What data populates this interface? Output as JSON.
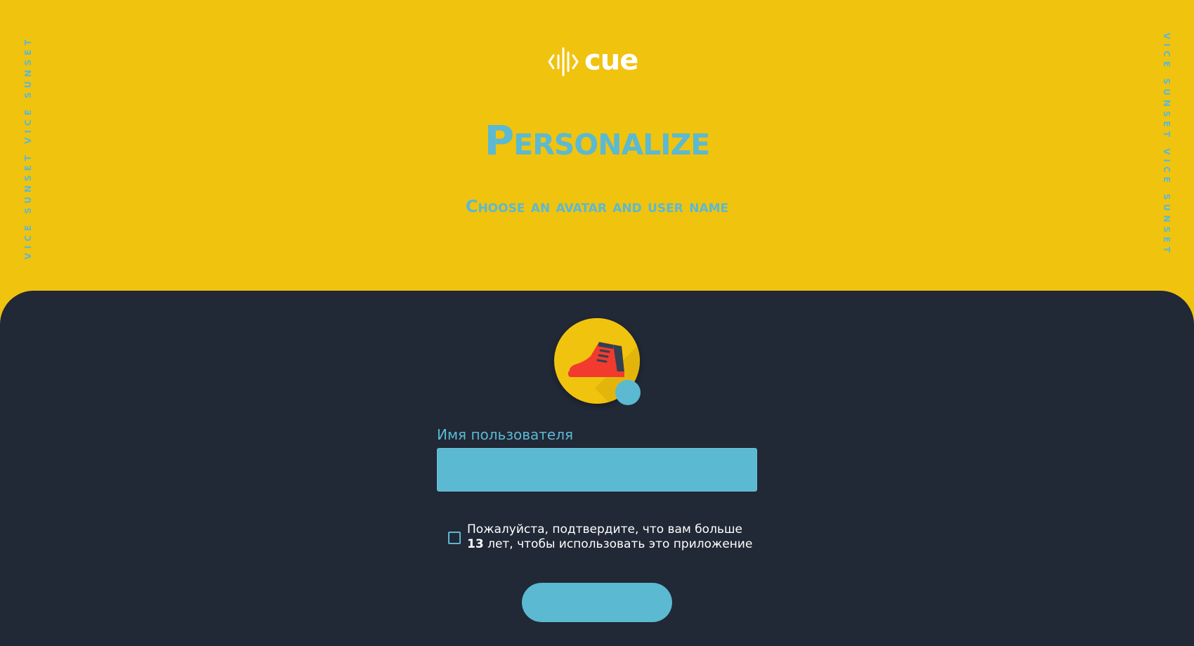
{
  "brand": {
    "logo_text": "cue",
    "icon": "waveform-icon"
  },
  "side_text": {
    "left": "VICE SUNSET VICE SUNSET",
    "right": "VICE SUNSET VICE SUNSET"
  },
  "header": {
    "title": "Personalize",
    "subtitle": "Choose an avatar and user name"
  },
  "avatar": {
    "icon": "sneaker-icon",
    "edit_icon": "avatar-edit-dot"
  },
  "form": {
    "username_label": "Имя пользователя",
    "username_value": "",
    "username_placeholder": "",
    "age_confirm_text_before": "Пожалуйста, подтвердите, что вам больше ",
    "age_confirm_number": "13",
    "age_confirm_text_after": " лет, чтобы использовать это приложение",
    "age_confirm_checked": false,
    "submit_label": ""
  },
  "colors": {
    "yellow": "#f0c30f",
    "dark": "#212836",
    "accent_blue": "#5bb9d2",
    "shoe_red": "#f23a2f",
    "white": "#ffffff"
  }
}
